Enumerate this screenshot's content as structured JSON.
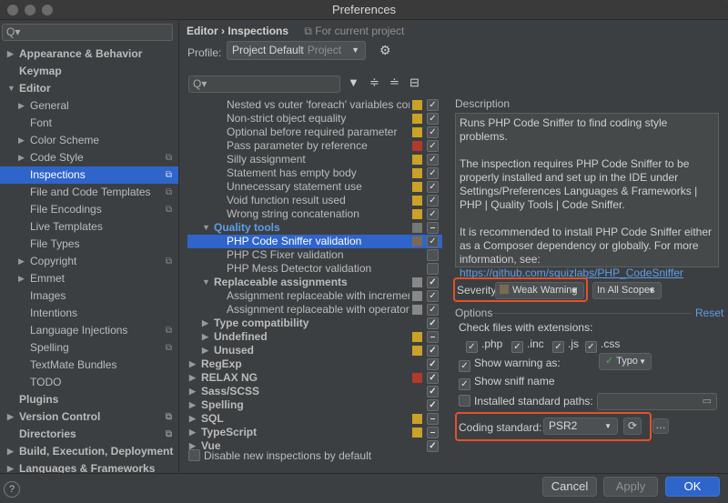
{
  "window": {
    "title": "Preferences"
  },
  "sidebar": {
    "search_placeholder": "Q▾",
    "items": [
      {
        "label": "Appearance & Behavior",
        "indent": 0,
        "arrow": "▶",
        "bold": true
      },
      {
        "label": "Keymap",
        "indent": 0,
        "arrow": "",
        "bold": true
      },
      {
        "label": "Editor",
        "indent": 0,
        "arrow": "▼",
        "bold": true
      },
      {
        "label": "General",
        "indent": 1,
        "arrow": "▶"
      },
      {
        "label": "Font",
        "indent": 1,
        "arrow": ""
      },
      {
        "label": "Color Scheme",
        "indent": 1,
        "arrow": "▶"
      },
      {
        "label": "Code Style",
        "indent": 1,
        "arrow": "▶",
        "copy": true
      },
      {
        "label": "Inspections",
        "indent": 1,
        "arrow": "",
        "selected": true,
        "copy": true
      },
      {
        "label": "File and Code Templates",
        "indent": 1,
        "arrow": "",
        "copy": true
      },
      {
        "label": "File Encodings",
        "indent": 1,
        "arrow": "",
        "copy": true
      },
      {
        "label": "Live Templates",
        "indent": 1,
        "arrow": ""
      },
      {
        "label": "File Types",
        "indent": 1,
        "arrow": ""
      },
      {
        "label": "Copyright",
        "indent": 1,
        "arrow": "▶",
        "copy": true
      },
      {
        "label": "Emmet",
        "indent": 1,
        "arrow": "▶"
      },
      {
        "label": "Images",
        "indent": 1,
        "arrow": ""
      },
      {
        "label": "Intentions",
        "indent": 1,
        "arrow": ""
      },
      {
        "label": "Language Injections",
        "indent": 1,
        "arrow": "",
        "copy": true
      },
      {
        "label": "Spelling",
        "indent": 1,
        "arrow": "",
        "copy": true
      },
      {
        "label": "TextMate Bundles",
        "indent": 1,
        "arrow": ""
      },
      {
        "label": "TODO",
        "indent": 1,
        "arrow": ""
      },
      {
        "label": "Plugins",
        "indent": 0,
        "arrow": "",
        "bold": true
      },
      {
        "label": "Version Control",
        "indent": 0,
        "arrow": "▶",
        "bold": true,
        "copy": true
      },
      {
        "label": "Directories",
        "indent": 0,
        "arrow": "",
        "bold": true,
        "copy": true
      },
      {
        "label": "Build, Execution, Deployment",
        "indent": 0,
        "arrow": "▶",
        "bold": true
      },
      {
        "label": "Languages & Frameworks",
        "indent": 0,
        "arrow": "▶",
        "bold": true
      }
    ]
  },
  "header": {
    "crumb1": "Editor",
    "sep": "›",
    "crumb2": "Inspections",
    "for_current": "For current project"
  },
  "profile": {
    "label": "Profile:",
    "value": "Project Default",
    "scope": "Project"
  },
  "inspection_search_placeholder": "Q▾",
  "inspections": [
    {
      "label": "Nested vs outer 'foreach' variables confli",
      "indent": 2,
      "sev": "#c9a227",
      "checked": true
    },
    {
      "label": "Non-strict object equality",
      "indent": 2,
      "sev": "#c9a227",
      "checked": true
    },
    {
      "label": "Optional before required parameter",
      "indent": 2,
      "sev": "#c9a227",
      "checked": true
    },
    {
      "label": "Pass parameter by reference",
      "indent": 2,
      "sev": "#b03a2e",
      "checked": true
    },
    {
      "label": "Silly assignment",
      "indent": 2,
      "sev": "#c9a227",
      "checked": true
    },
    {
      "label": "Statement has empty body",
      "indent": 2,
      "sev": "#c9a227",
      "checked": true
    },
    {
      "label": "Unnecessary statement use",
      "indent": 2,
      "sev": "#c9a227",
      "checked": true
    },
    {
      "label": "Void function result used",
      "indent": 2,
      "sev": "#c9a227",
      "checked": true
    },
    {
      "label": "Wrong string concatenation",
      "indent": 2,
      "sev": "#c9a227",
      "checked": true
    },
    {
      "label": "Quality tools",
      "indent": 1,
      "arrow": "▼",
      "type": "qt",
      "sev": "#777777",
      "checked": "partial"
    },
    {
      "label": "PHP Code Sniffer validation",
      "indent": 2,
      "sev": "#7a6a55",
      "checked": true,
      "selected": true
    },
    {
      "label": "PHP CS Fixer validation",
      "indent": 2,
      "sev": "",
      "checked": false
    },
    {
      "label": "PHP Mess Detector validation",
      "indent": 2,
      "sev": "",
      "checked": false
    },
    {
      "label": "Replaceable assignments",
      "indent": 1,
      "arrow": "▼",
      "type": "cat",
      "sev": "#888888",
      "checked": true
    },
    {
      "label": "Assignment replaceable with increment o",
      "indent": 2,
      "sev": "#888888",
      "checked": true
    },
    {
      "label": "Assignment replaceable with operator as",
      "indent": 2,
      "sev": "#888888",
      "checked": true
    },
    {
      "label": "Type compatibility",
      "indent": 1,
      "arrow": "▶",
      "type": "cat",
      "sev": "",
      "checked": true
    },
    {
      "label": "Undefined",
      "indent": 1,
      "arrow": "▶",
      "type": "cat",
      "sev": "#c9a227",
      "checked": "partial"
    },
    {
      "label": "Unused",
      "indent": 1,
      "arrow": "▶",
      "type": "cat",
      "sev": "#c9a227",
      "checked": true
    },
    {
      "label": "RegExp",
      "indent": 0,
      "arrow": "▶",
      "type": "cat",
      "sev": "",
      "checked": true
    },
    {
      "label": "RELAX NG",
      "indent": 0,
      "arrow": "▶",
      "type": "cat",
      "sev": "#b03a2e",
      "checked": true
    },
    {
      "label": "Sass/SCSS",
      "indent": 0,
      "arrow": "▶",
      "type": "cat",
      "sev": "",
      "checked": true
    },
    {
      "label": "Spelling",
      "indent": 0,
      "arrow": "▶",
      "type": "cat",
      "sev": "",
      "checked": true
    },
    {
      "label": "SQL",
      "indent": 0,
      "arrow": "▶",
      "type": "cat",
      "sev": "#c9a227",
      "checked": "partial"
    },
    {
      "label": "TypeScript",
      "indent": 0,
      "arrow": "▶",
      "type": "cat",
      "sev": "#c9a227",
      "checked": "partial"
    },
    {
      "label": "Vue",
      "indent": 0,
      "arrow": "▶",
      "type": "cat",
      "sev": "",
      "checked": true
    }
  ],
  "disable_new": "Disable new inspections by default",
  "description": {
    "label": "Description",
    "p1": "Runs PHP Code Sniffer to find coding style problems.",
    "p2": "The inspection requires PHP Code Sniffer to be properly installed and set up in the IDE under Settings/Preferences Languages & Frameworks | PHP | Quality Tools | Code Sniffer.",
    "p3": "It is recommended to install PHP Code Sniffer either as a Composer dependency or globally. For more information, see:",
    "link": "https://github.com/squizlabs/PHP_CodeSniffer"
  },
  "severity": {
    "label": "Severity:",
    "value": "Weak Warning",
    "scope": "In All Scopes"
  },
  "options": {
    "label": "Options",
    "reset": "Reset",
    "check_ext": "Check files with extensions:",
    "extensions": [
      ".php",
      ".inc",
      ".js",
      ".css"
    ],
    "show_warning": "Show warning as:",
    "warning_value": "Typo",
    "show_sniff": "Show sniff name",
    "installed_paths": "Installed standard paths:",
    "coding_standard": "Coding standard:",
    "coding_value": "PSR2"
  },
  "footer": {
    "cancel": "Cancel",
    "apply": "Apply",
    "ok": "OK"
  },
  "colors": {
    "accent": "#2f65ca",
    "highlight": "#e0522c",
    "link": "#5c9eea"
  }
}
